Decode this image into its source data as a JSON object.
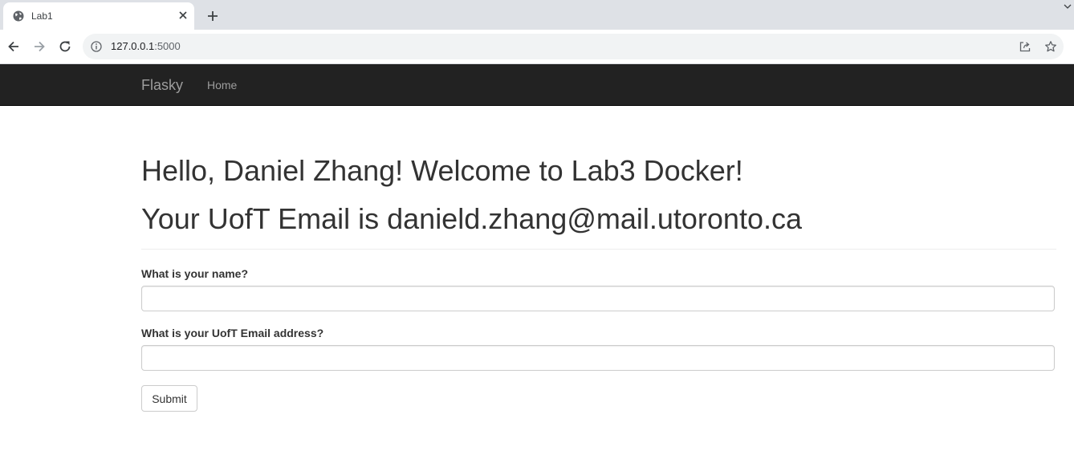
{
  "browser": {
    "tab": {
      "title": "Lab1",
      "favicon": "globe-icon",
      "close_icon": "close-icon"
    },
    "new_tab_icon": "plus-icon",
    "address": {
      "host": "127.0.0.1",
      "port": ":5000"
    }
  },
  "navbar": {
    "brand": "Flasky",
    "links": [
      {
        "label": "Home"
      }
    ],
    "background": "#222222"
  },
  "main": {
    "greeting": "Hello, Daniel Zhang! Welcome to Lab3 Docker!",
    "email_line": "Your UofT Email is danield.zhang@mail.utoronto.ca",
    "form": {
      "name_label": "What is your name?",
      "name_value": "",
      "email_label": "What is your UofT Email address?",
      "email_value": "",
      "submit_label": "Submit"
    }
  }
}
